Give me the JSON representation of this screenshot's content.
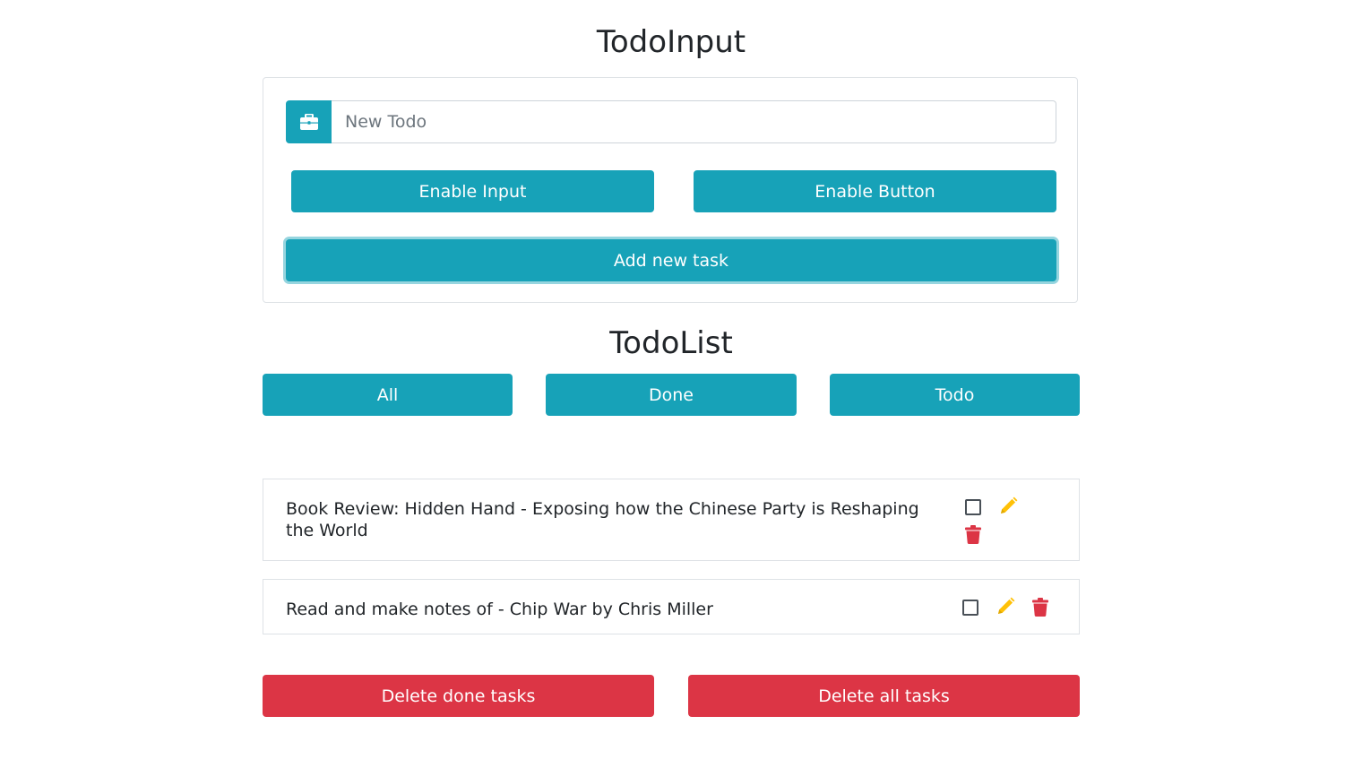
{
  "input_section": {
    "title": "TodoInput",
    "input_icon": "briefcase-icon",
    "input_placeholder": "New Todo",
    "input_value": "",
    "enable_input_label": "Enable Input",
    "enable_button_label": "Enable Button",
    "add_task_label": "Add new task"
  },
  "list_section": {
    "title": "TodoList",
    "filters": [
      {
        "label": "All"
      },
      {
        "label": "Done"
      },
      {
        "label": "Todo"
      }
    ],
    "items": [
      {
        "text": "Book Review: Hidden Hand - Exposing how the Chinese Party is Reshaping the World",
        "done": false,
        "icons": [
          "checkbox-icon",
          "pencil-icon",
          "trash-icon"
        ]
      },
      {
        "text": "Read and make notes of - Chip War by Chris Miller",
        "done": false,
        "icons": [
          "checkbox-icon",
          "pencil-icon",
          "trash-icon"
        ]
      }
    ],
    "delete_done_label": "Delete done tasks",
    "delete_all_label": "Delete all tasks"
  },
  "colors": {
    "info": "#17a2b8",
    "danger": "#dc3545",
    "warning": "#ffc107",
    "border": "#dee2e6"
  }
}
